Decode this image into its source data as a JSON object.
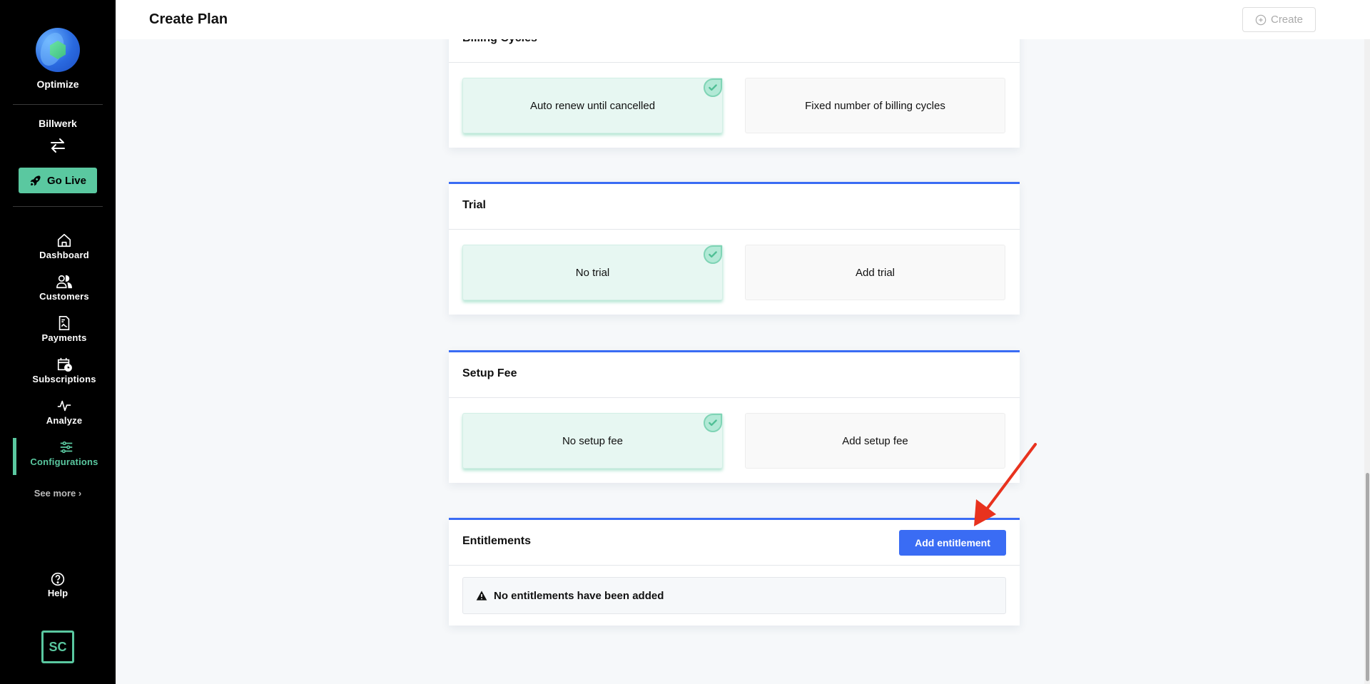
{
  "sidebar": {
    "brand": "Optimize",
    "account": "Billwerk",
    "go_live_label": "Go Live",
    "nav": [
      {
        "label": "Dashboard",
        "icon": "home-icon",
        "active": false
      },
      {
        "label": "Customers",
        "icon": "users-icon",
        "active": false
      },
      {
        "label": "Payments",
        "icon": "document-icon",
        "active": false
      },
      {
        "label": "Subscriptions",
        "icon": "calendar-clock-icon",
        "active": false
      },
      {
        "label": "Analyze",
        "icon": "pulse-icon",
        "active": false
      },
      {
        "label": "Configurations",
        "icon": "sliders-icon",
        "active": true
      }
    ],
    "see_more": "See more",
    "help": "Help",
    "avatar_initials": "SC",
    "accent_color": "#5ac8a0"
  },
  "header": {
    "title": "Create Plan",
    "create_label": "Create"
  },
  "sections": {
    "billing_cycles": {
      "title": "Billing Cycles",
      "options": [
        {
          "label": "Auto renew until cancelled",
          "selected": true
        },
        {
          "label": "Fixed number of billing cycles",
          "selected": false
        }
      ]
    },
    "trial": {
      "title": "Trial",
      "options": [
        {
          "label": "No trial",
          "selected": true
        },
        {
          "label": "Add trial",
          "selected": false
        }
      ]
    },
    "setup_fee": {
      "title": "Setup Fee",
      "options": [
        {
          "label": "No setup fee",
          "selected": true
        },
        {
          "label": "Add setup fee",
          "selected": false
        }
      ]
    },
    "entitlements": {
      "title": "Entitlements",
      "add_label": "Add entitlement",
      "empty_message": "No entitlements have been added"
    }
  },
  "colors": {
    "primary": "#3a6cf4",
    "selected_bg": "#e7f7f2",
    "annotation": "#e8321e"
  }
}
